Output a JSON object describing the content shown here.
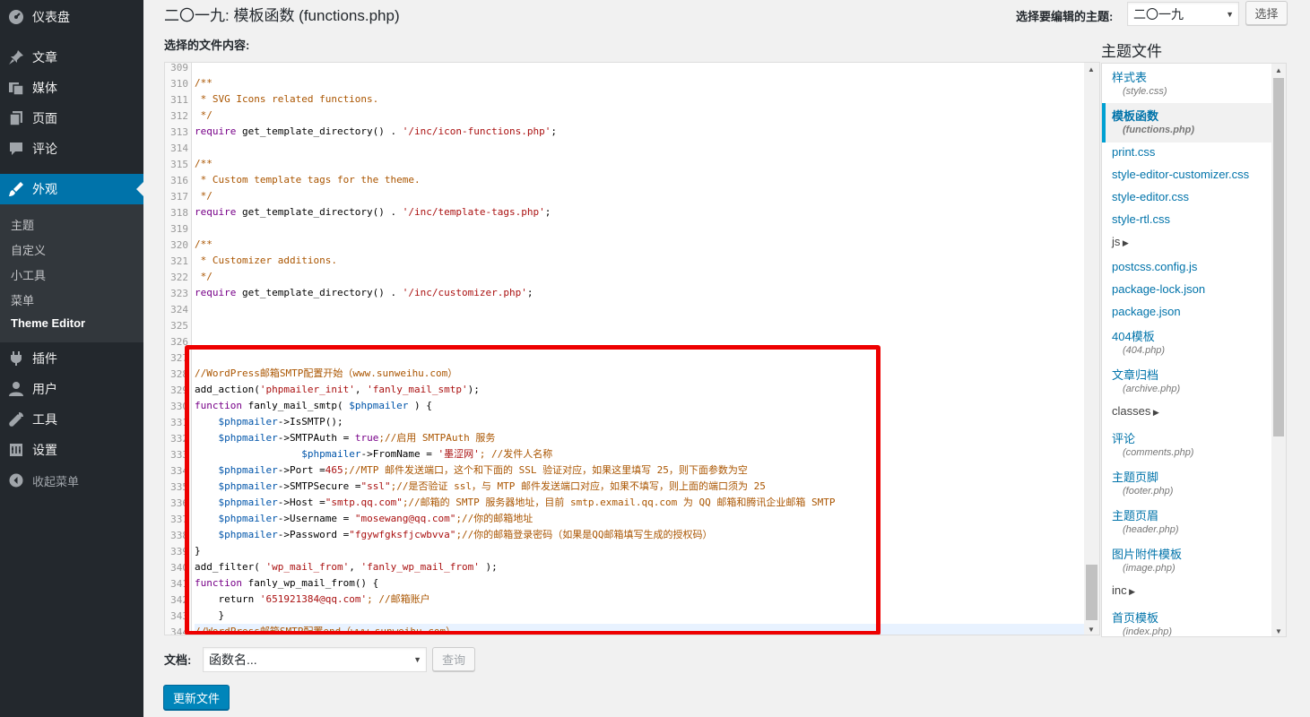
{
  "sidebar": {
    "menu": [
      {
        "label": "仪表盘",
        "icon": "dashboard-icon"
      },
      {
        "label": "文章",
        "icon": "pin-icon"
      },
      {
        "label": "媒体",
        "icon": "media-icon"
      },
      {
        "label": "页面",
        "icon": "page-icon"
      },
      {
        "label": "评论",
        "icon": "comment-icon"
      },
      {
        "label": "外观",
        "icon": "appearance-brush-icon"
      },
      {
        "label": "插件",
        "icon": "plugin-icon"
      },
      {
        "label": "用户",
        "icon": "user-icon"
      },
      {
        "label": "工具",
        "icon": "wrench-icon"
      },
      {
        "label": "设置",
        "icon": "settings-icon"
      }
    ],
    "submenu": [
      "主题",
      "自定义",
      "小工具",
      "菜单",
      "Theme Editor"
    ],
    "collapse_label": "收起菜单"
  },
  "header": {
    "title": "二〇一九: 模板函数 (functions.php)",
    "theme_select_label": "选择要编辑的主题:",
    "theme_select_value": "二〇一九",
    "select_button": "选择"
  },
  "editor": {
    "file_content_label": "选择的文件内容:",
    "lines": [
      {
        "n": "309",
        "segs": [
          {
            "t": "",
            "c": ""
          }
        ]
      },
      {
        "n": "310",
        "segs": [
          {
            "t": "/**",
            "c": "cm"
          }
        ]
      },
      {
        "n": "311",
        "segs": [
          {
            "t": " * SVG Icons related functions.",
            "c": "cm"
          }
        ]
      },
      {
        "n": "312",
        "segs": [
          {
            "t": " */",
            "c": "cm"
          }
        ]
      },
      {
        "n": "313",
        "segs": [
          {
            "t": "require",
            "c": "kw"
          },
          {
            "t": " get_template_directory() . ",
            "c": ""
          },
          {
            "t": "'/inc/icon-functions.php'",
            "c": "st"
          },
          {
            "t": ";",
            "c": ""
          }
        ]
      },
      {
        "n": "314",
        "segs": [
          {
            "t": "",
            "c": ""
          }
        ]
      },
      {
        "n": "315",
        "segs": [
          {
            "t": "/**",
            "c": "cm"
          }
        ]
      },
      {
        "n": "316",
        "segs": [
          {
            "t": " * Custom template tags for the theme.",
            "c": "cm"
          }
        ]
      },
      {
        "n": "317",
        "segs": [
          {
            "t": " */",
            "c": "cm"
          }
        ]
      },
      {
        "n": "318",
        "segs": [
          {
            "t": "require",
            "c": "kw"
          },
          {
            "t": " get_template_directory() . ",
            "c": ""
          },
          {
            "t": "'/inc/template-tags.php'",
            "c": "st"
          },
          {
            "t": ";",
            "c": ""
          }
        ]
      },
      {
        "n": "319",
        "segs": [
          {
            "t": "",
            "c": ""
          }
        ]
      },
      {
        "n": "320",
        "segs": [
          {
            "t": "/**",
            "c": "cm"
          }
        ]
      },
      {
        "n": "321",
        "segs": [
          {
            "t": " * Customizer additions.",
            "c": "cm"
          }
        ]
      },
      {
        "n": "322",
        "segs": [
          {
            "t": " */",
            "c": "cm"
          }
        ]
      },
      {
        "n": "323",
        "segs": [
          {
            "t": "require",
            "c": "kw"
          },
          {
            "t": " get_template_directory() . ",
            "c": ""
          },
          {
            "t": "'/inc/customizer.php'",
            "c": "st"
          },
          {
            "t": ";",
            "c": ""
          }
        ]
      },
      {
        "n": "324",
        "segs": [
          {
            "t": "",
            "c": ""
          }
        ]
      },
      {
        "n": "325",
        "segs": [
          {
            "t": "",
            "c": ""
          }
        ]
      },
      {
        "n": "326",
        "segs": [
          {
            "t": "",
            "c": ""
          }
        ]
      },
      {
        "n": "327",
        "segs": [
          {
            "t": "",
            "c": ""
          }
        ]
      },
      {
        "n": "328",
        "segs": [
          {
            "t": "//WordPress邮箱SMTP配置开始（www.sunweihu.com）",
            "c": "cm"
          }
        ]
      },
      {
        "n": "329",
        "segs": [
          {
            "t": "add_action(",
            "c": ""
          },
          {
            "t": "'phpmailer_init'",
            "c": "st"
          },
          {
            "t": ", ",
            "c": ""
          },
          {
            "t": "'fanly_mail_smtp'",
            "c": "st"
          },
          {
            "t": ");",
            "c": ""
          }
        ]
      },
      {
        "n": "330",
        "segs": [
          {
            "t": "function",
            "c": "kw"
          },
          {
            "t": " fanly_mail_smtp( ",
            "c": ""
          },
          {
            "t": "$phpmailer",
            "c": "va"
          },
          {
            "t": " ) {",
            "c": ""
          }
        ]
      },
      {
        "n": "331",
        "segs": [
          {
            "t": "    ",
            "c": ""
          },
          {
            "t": "$phpmailer",
            "c": "va"
          },
          {
            "t": "->IsSMTP();",
            "c": ""
          }
        ]
      },
      {
        "n": "332",
        "segs": [
          {
            "t": "    ",
            "c": ""
          },
          {
            "t": "$phpmailer",
            "c": "va"
          },
          {
            "t": "->SMTPAuth = ",
            "c": ""
          },
          {
            "t": "true",
            "c": "kw"
          },
          {
            "t": ";//启用 SMTPAuth 服务",
            "c": "cm"
          }
        ]
      },
      {
        "n": "333",
        "segs": [
          {
            "t": "                  ",
            "c": ""
          },
          {
            "t": "$phpmailer",
            "c": "va"
          },
          {
            "t": "->FromName = ",
            "c": ""
          },
          {
            "t": "'墨涩网'",
            "c": "st"
          },
          {
            "t": "; //发件人名称",
            "c": "cm"
          }
        ]
      },
      {
        "n": "334",
        "segs": [
          {
            "t": "    ",
            "c": ""
          },
          {
            "t": "$phpmailer",
            "c": "va"
          },
          {
            "t": "->Port =",
            "c": ""
          },
          {
            "t": "465",
            "c": "st"
          },
          {
            "t": ";//MTP 邮件发送端口，这个和下面的 SSL 验证对应，如果这里填写 25，则下面参数为空",
            "c": "cm"
          }
        ]
      },
      {
        "n": "335",
        "segs": [
          {
            "t": "    ",
            "c": ""
          },
          {
            "t": "$phpmailer",
            "c": "va"
          },
          {
            "t": "->SMTPSecure =",
            "c": ""
          },
          {
            "t": "\"ssl\"",
            "c": "st"
          },
          {
            "t": ";//是否验证 ssl，与 MTP 邮件发送端口对应，如果不填写，则上面的端口须为 25",
            "c": "cm"
          }
        ]
      },
      {
        "n": "336",
        "segs": [
          {
            "t": "    ",
            "c": ""
          },
          {
            "t": "$phpmailer",
            "c": "va"
          },
          {
            "t": "->Host =",
            "c": ""
          },
          {
            "t": "\"smtp.qq.com\"",
            "c": "st"
          },
          {
            "t": ";//邮箱的 SMTP 服务器地址，目前 smtp.exmail.qq.com 为 QQ 邮箱和腾讯企业邮箱 SMTP",
            "c": "cm"
          }
        ]
      },
      {
        "n": "337",
        "segs": [
          {
            "t": "    ",
            "c": ""
          },
          {
            "t": "$phpmailer",
            "c": "va"
          },
          {
            "t": "->Username = ",
            "c": ""
          },
          {
            "t": "\"mosewang@qq.com\"",
            "c": "st"
          },
          {
            "t": ";//你的邮箱地址",
            "c": "cm"
          }
        ]
      },
      {
        "n": "338",
        "segs": [
          {
            "t": "    ",
            "c": ""
          },
          {
            "t": "$phpmailer",
            "c": "va"
          },
          {
            "t": "->Password =",
            "c": ""
          },
          {
            "t": "\"fgywfgksfjcwbvva\"",
            "c": "st"
          },
          {
            "t": ";//你的邮箱登录密码（如果是QQ邮箱填写生成的授权码）",
            "c": "cm"
          }
        ]
      },
      {
        "n": "339",
        "segs": [
          {
            "t": "}",
            "c": ""
          }
        ]
      },
      {
        "n": "340",
        "segs": [
          {
            "t": "add_filter( ",
            "c": ""
          },
          {
            "t": "'wp_mail_from'",
            "c": "st"
          },
          {
            "t": ", ",
            "c": ""
          },
          {
            "t": "'fanly_wp_mail_from'",
            "c": "st"
          },
          {
            "t": " );",
            "c": ""
          }
        ]
      },
      {
        "n": "341",
        "segs": [
          {
            "t": "function",
            "c": "kw"
          },
          {
            "t": " fanly_wp_mail_from() {",
            "c": ""
          }
        ]
      },
      {
        "n": "342",
        "segs": [
          {
            "t": "    return ",
            "c": ""
          },
          {
            "t": "'651921384@qq.com'",
            "c": "st"
          },
          {
            "t": "; //邮箱账户",
            "c": "cm"
          }
        ]
      },
      {
        "n": "343",
        "segs": [
          {
            "t": "    }",
            "c": ""
          }
        ]
      },
      {
        "n": "344",
        "segs": [
          {
            "t": "//WordPress邮箱SMTP配置end（www.sunweihu.com）",
            "c": "cm"
          }
        ]
      }
    ]
  },
  "files_panel": {
    "heading": "主题文件",
    "items": [
      {
        "label": "样式表",
        "sub": "(style.css)",
        "type": "file",
        "active": false
      },
      {
        "label": "模板函数",
        "sub": "(functions.php)",
        "type": "file",
        "active": true
      },
      {
        "label": "print.css",
        "sub": "",
        "type": "file",
        "active": false
      },
      {
        "label": "style-editor-customizer.css",
        "sub": "",
        "type": "file",
        "active": false
      },
      {
        "label": "style-editor.css",
        "sub": "",
        "type": "file",
        "active": false
      },
      {
        "label": "style-rtl.css",
        "sub": "",
        "type": "file",
        "active": false
      },
      {
        "label": "js",
        "sub": "",
        "type": "dir",
        "active": false
      },
      {
        "label": "postcss.config.js",
        "sub": "",
        "type": "file",
        "active": false
      },
      {
        "label": "package-lock.json",
        "sub": "",
        "type": "file",
        "active": false
      },
      {
        "label": "package.json",
        "sub": "",
        "type": "file",
        "active": false
      },
      {
        "label": "404模板",
        "sub": "(404.php)",
        "type": "file",
        "active": false
      },
      {
        "label": "文章归档",
        "sub": "(archive.php)",
        "type": "file",
        "active": false
      },
      {
        "label": "classes",
        "sub": "",
        "type": "dir",
        "active": false
      },
      {
        "label": "评论",
        "sub": "(comments.php)",
        "type": "file",
        "active": false
      },
      {
        "label": "主题页脚",
        "sub": "(footer.php)",
        "type": "file",
        "active": false
      },
      {
        "label": "主题页眉",
        "sub": "(header.php)",
        "type": "file",
        "active": false
      },
      {
        "label": "图片附件模板",
        "sub": "(image.php)",
        "type": "file",
        "active": false
      },
      {
        "label": "inc",
        "sub": "",
        "type": "dir",
        "active": false
      },
      {
        "label": "首页模板",
        "sub": "(index.php)",
        "type": "file",
        "active": false
      }
    ]
  },
  "footer": {
    "doc_label": "文档:",
    "doc_select_value": "函数名...",
    "lookup_button": "查询",
    "update_button": "更新文件"
  }
}
